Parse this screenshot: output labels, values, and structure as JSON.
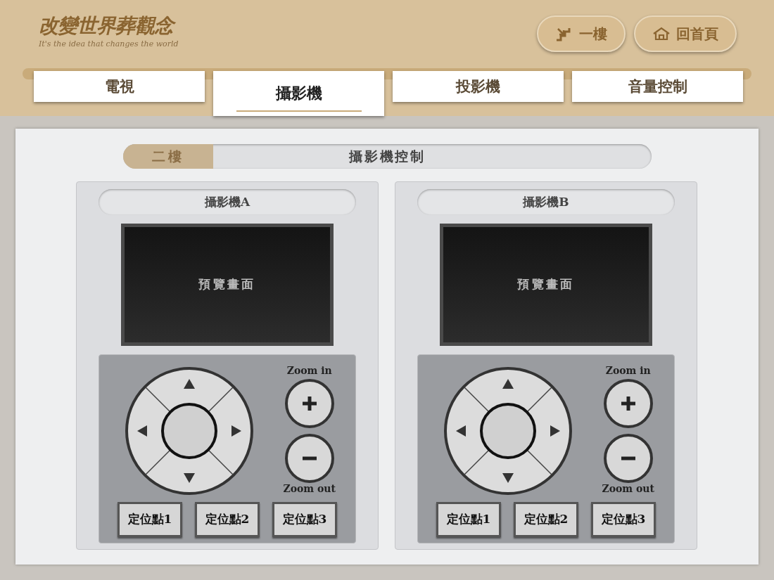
{
  "header": {
    "logo_title": "改變世界葬觀念",
    "logo_tagline": "It's the idea that changes the world",
    "buttons": [
      {
        "label": "一樓",
        "kind": "stairs"
      },
      {
        "label": "回首頁",
        "kind": "home"
      }
    ]
  },
  "tabs": [
    {
      "label": "電視",
      "selected": false
    },
    {
      "label": "攝影機",
      "selected": true
    },
    {
      "label": "投影機",
      "selected": false
    },
    {
      "label": "音量控制",
      "selected": false
    }
  ],
  "floor_bar": {
    "floor": "二樓",
    "title": "攝影機控制"
  },
  "cameras": [
    {
      "title": "攝影機A",
      "preview": "預覽畫面",
      "zoom_in": "Zoom in",
      "zoom_out": "Zoom out",
      "presets": [
        "定位點1",
        "定位點2",
        "定位點3"
      ]
    },
    {
      "title": "攝影機B",
      "preview": "預覽畫面",
      "zoom_in": "Zoom in",
      "zoom_out": "Zoom out",
      "presets": [
        "定位點1",
        "定位點2",
        "定位點3"
      ]
    }
  ]
}
